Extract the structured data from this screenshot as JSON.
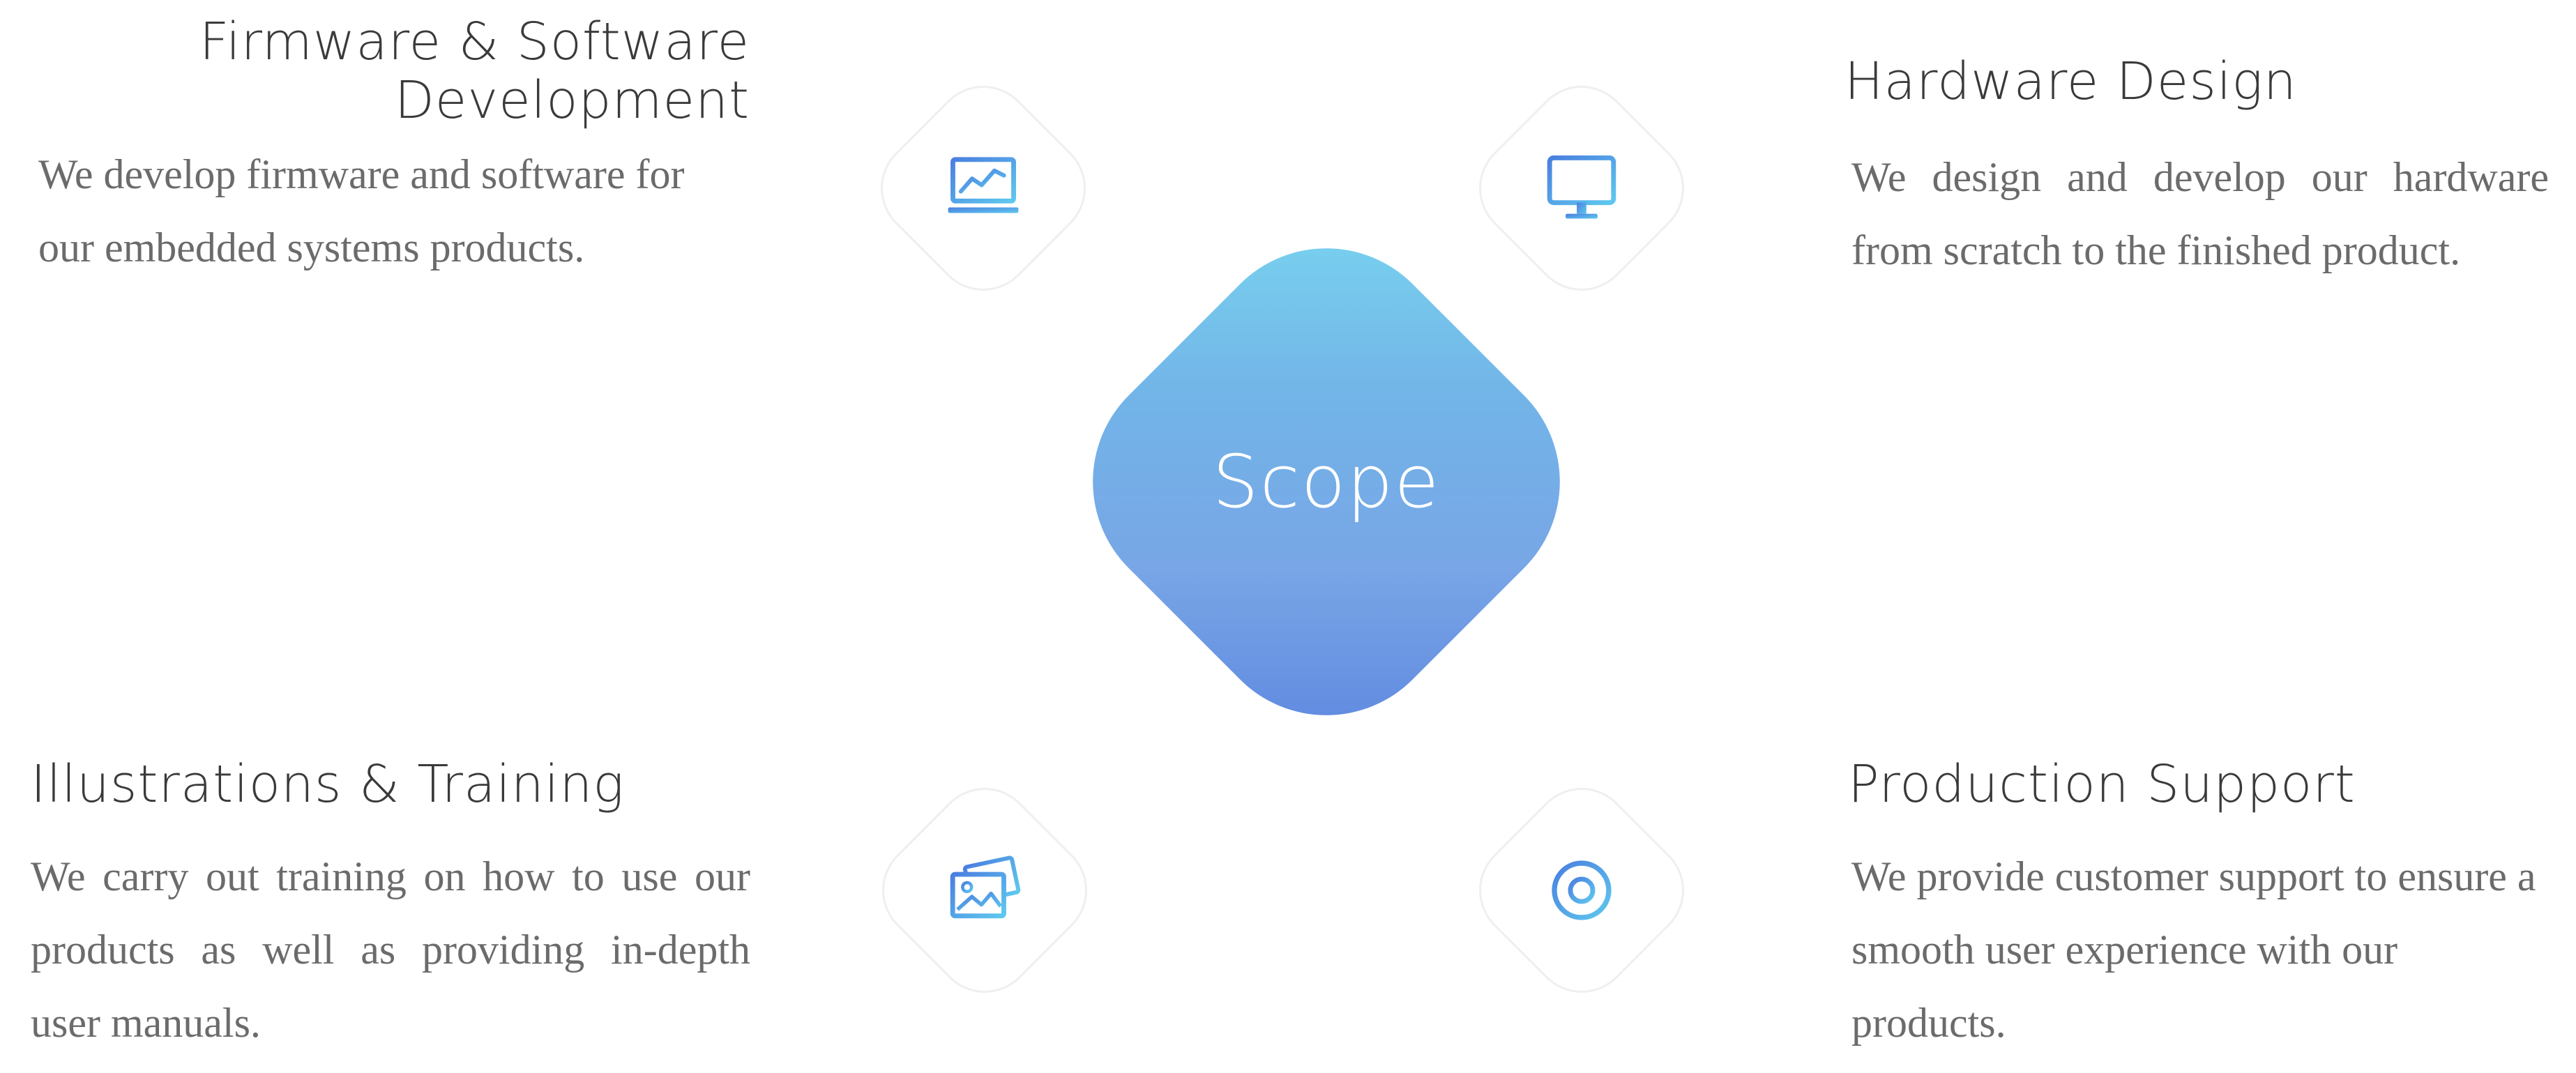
{
  "center": {
    "label": "Scope"
  },
  "features": {
    "firmware": {
      "title_line1": "Firmware & Software",
      "title_line2": "Development",
      "description": "We develop firmware and software for our embedded systems products.",
      "icon": "laptop-chart-icon"
    },
    "hardware": {
      "title": "Hardware Design",
      "description": "We design and develop our hardware from scratch to the finished product.",
      "icon": "monitor-icon"
    },
    "illustrations": {
      "title": "Illustrations & Training",
      "description": "We carry out training on how to use our products as well as providing in-depth user manuals.",
      "icon": "images-icon"
    },
    "production": {
      "title": "Production Support",
      "description": "We provide customer support to ensure a smooth user experience with our products.",
      "icon": "lifebuoy-icon"
    }
  },
  "colors": {
    "gradient_start": "#5b84df",
    "gradient_end": "#79d7f0",
    "icon_blue": "#4a7fe0",
    "icon_cyan": "#5ec8ee",
    "heading": "#3a3a3a",
    "text": "#6b6b6b"
  }
}
